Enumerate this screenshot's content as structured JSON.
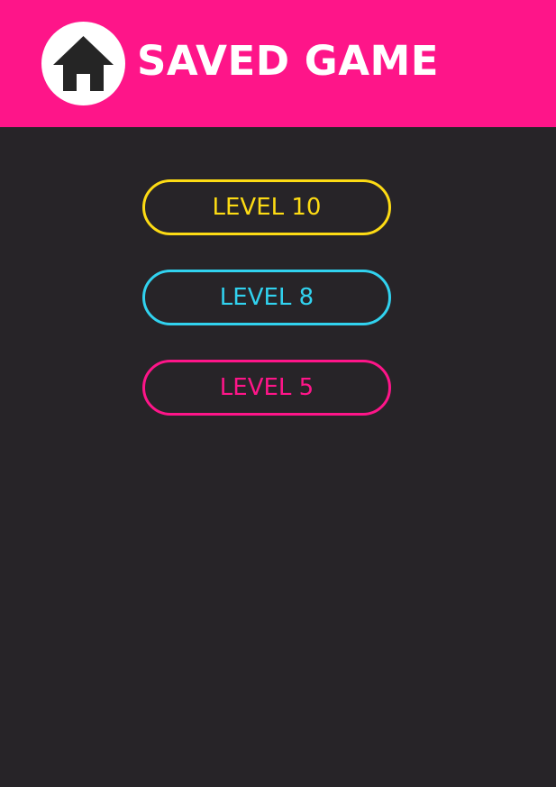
{
  "header": {
    "title": "SAVED GAME",
    "home_icon": "home-icon",
    "background_color": "#fe1589"
  },
  "levels": [
    {
      "label": "LEVEL 10",
      "color": "#fddb14"
    },
    {
      "label": "LEVEL 8",
      "color": "#31d2ef"
    },
    {
      "label": "LEVEL 5",
      "color": "#fe1589"
    }
  ],
  "theme": {
    "background_color": "#272428",
    "title_color": "#ffffff",
    "icon_color": "#252525"
  }
}
